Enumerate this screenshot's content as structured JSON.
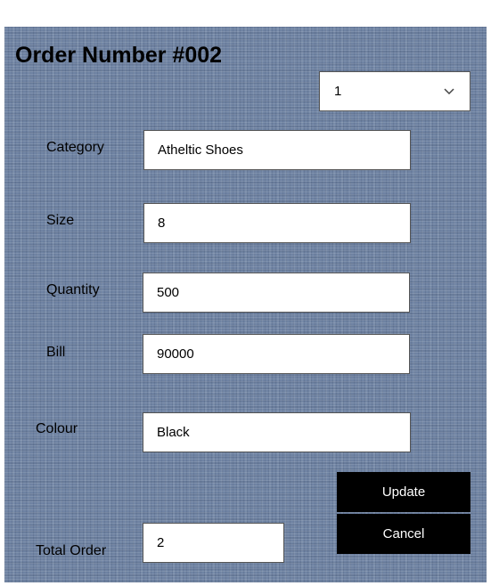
{
  "form": {
    "title": "Order Number #002",
    "selector": {
      "value": "1",
      "icon": "chevron-down-icon"
    },
    "fields": {
      "category": {
        "label": "Category",
        "value": "Atheltic Shoes"
      },
      "size": {
        "label": "Size",
        "value": "8"
      },
      "quantity": {
        "label": "Quantity",
        "value": "500"
      },
      "bill": {
        "label": "Bill",
        "value": "90000"
      },
      "colour": {
        "label": "Colour",
        "value": "Black"
      },
      "total_order": {
        "label": "Total Order",
        "value": "2"
      }
    },
    "buttons": {
      "update": "Update",
      "cancel": "Cancel"
    },
    "colors": {
      "button_bg": "#000000",
      "button_text": "#ffffff",
      "background": "#6f83a3"
    }
  }
}
